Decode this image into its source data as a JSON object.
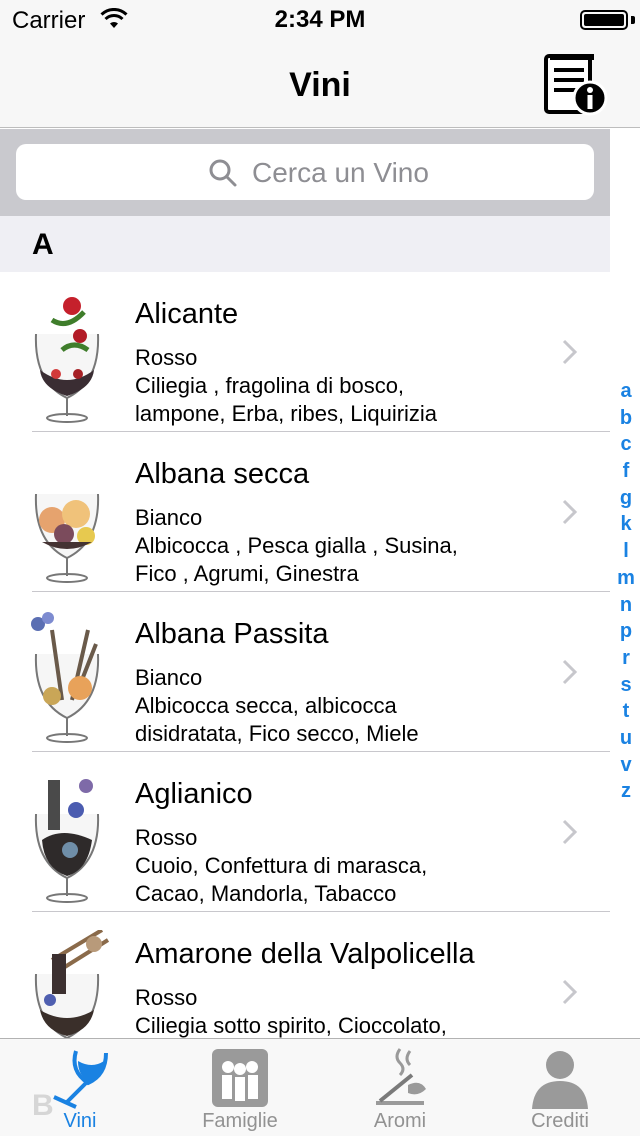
{
  "status_bar": {
    "carrier": "Carrier",
    "time": "2:34 PM"
  },
  "nav": {
    "title": "Vini",
    "right_icon": "info-book-icon"
  },
  "search": {
    "placeholder": "Cerca un Vino"
  },
  "section": {
    "letter": "A",
    "next_letter": "B"
  },
  "wines": [
    {
      "name": "Alicante",
      "type": "Rosso",
      "aromas": "Ciliegia  , fragolina di bosco, lampone, Erba, ribes, Liquirizia"
    },
    {
      "name": "Albana secca",
      "type": "Bianco",
      "aromas": "Albicocca  , Pesca gialla , Susina, Fico  , Agrumi, Ginestra"
    },
    {
      "name": "Albana Passita",
      "type": "Bianco",
      "aromas": "Albicocca secca, albicocca disidratata, Fico secco, Miele"
    },
    {
      "name": "Aglianico",
      "type": "Rosso",
      "aromas": "Cuoio, Confettura di marasca, Cacao, Mandorla, Tabacco"
    },
    {
      "name": "Amarone della Valpolicella",
      "type": "Rosso",
      "aromas": "Ciliegia sotto spirito, Cioccolato, Fondo di caffè, Spezie"
    }
  ],
  "index_letters": [
    "a",
    "b",
    "c",
    "f",
    "g",
    "k",
    "l",
    "m",
    "n",
    "p",
    "r",
    "s",
    "t",
    "u",
    "v",
    "z"
  ],
  "tabs": [
    {
      "label": "Vini",
      "icon": "wine-glass-icon",
      "active": true
    },
    {
      "label": "Famiglie",
      "icon": "family-icon",
      "active": false
    },
    {
      "label": "Aromi",
      "icon": "aroma-icon",
      "active": false
    },
    {
      "label": "Crediti",
      "icon": "person-icon",
      "active": false
    }
  ],
  "colors": {
    "accent": "#1a82e2",
    "inactive": "#929292",
    "section_bg": "#efeff4"
  }
}
